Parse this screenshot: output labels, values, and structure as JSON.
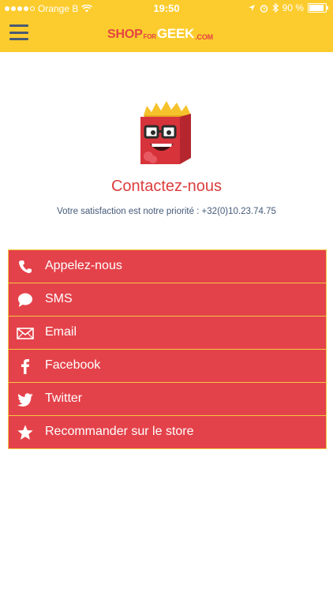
{
  "status_bar": {
    "carrier": "Orange B",
    "time": "19:50",
    "battery": "90 %"
  },
  "header": {
    "logo": {
      "shop": "SHOP",
      "for": "FOR",
      "geek": "GEEK",
      "com": ".COM"
    }
  },
  "contact": {
    "title": "Contactez-nous",
    "subtitle": "Votre satisfaction est notre priorité : +32(0)10.23.74.75"
  },
  "actions": [
    {
      "label": "Appelez-nous",
      "icon": "phone-icon"
    },
    {
      "label": "SMS",
      "icon": "chat-bubble-icon"
    },
    {
      "label": "Email",
      "icon": "envelope-icon"
    },
    {
      "label": "Facebook",
      "icon": "facebook-icon"
    },
    {
      "label": "Twitter",
      "icon": "twitter-bird-icon"
    },
    {
      "label": "Recommander sur le store",
      "icon": "star-icon"
    }
  ],
  "colors": {
    "header": "#fccc2e",
    "accent": "#e4424a",
    "title": "#dd3d3d",
    "subtitle": "#455a7a"
  }
}
